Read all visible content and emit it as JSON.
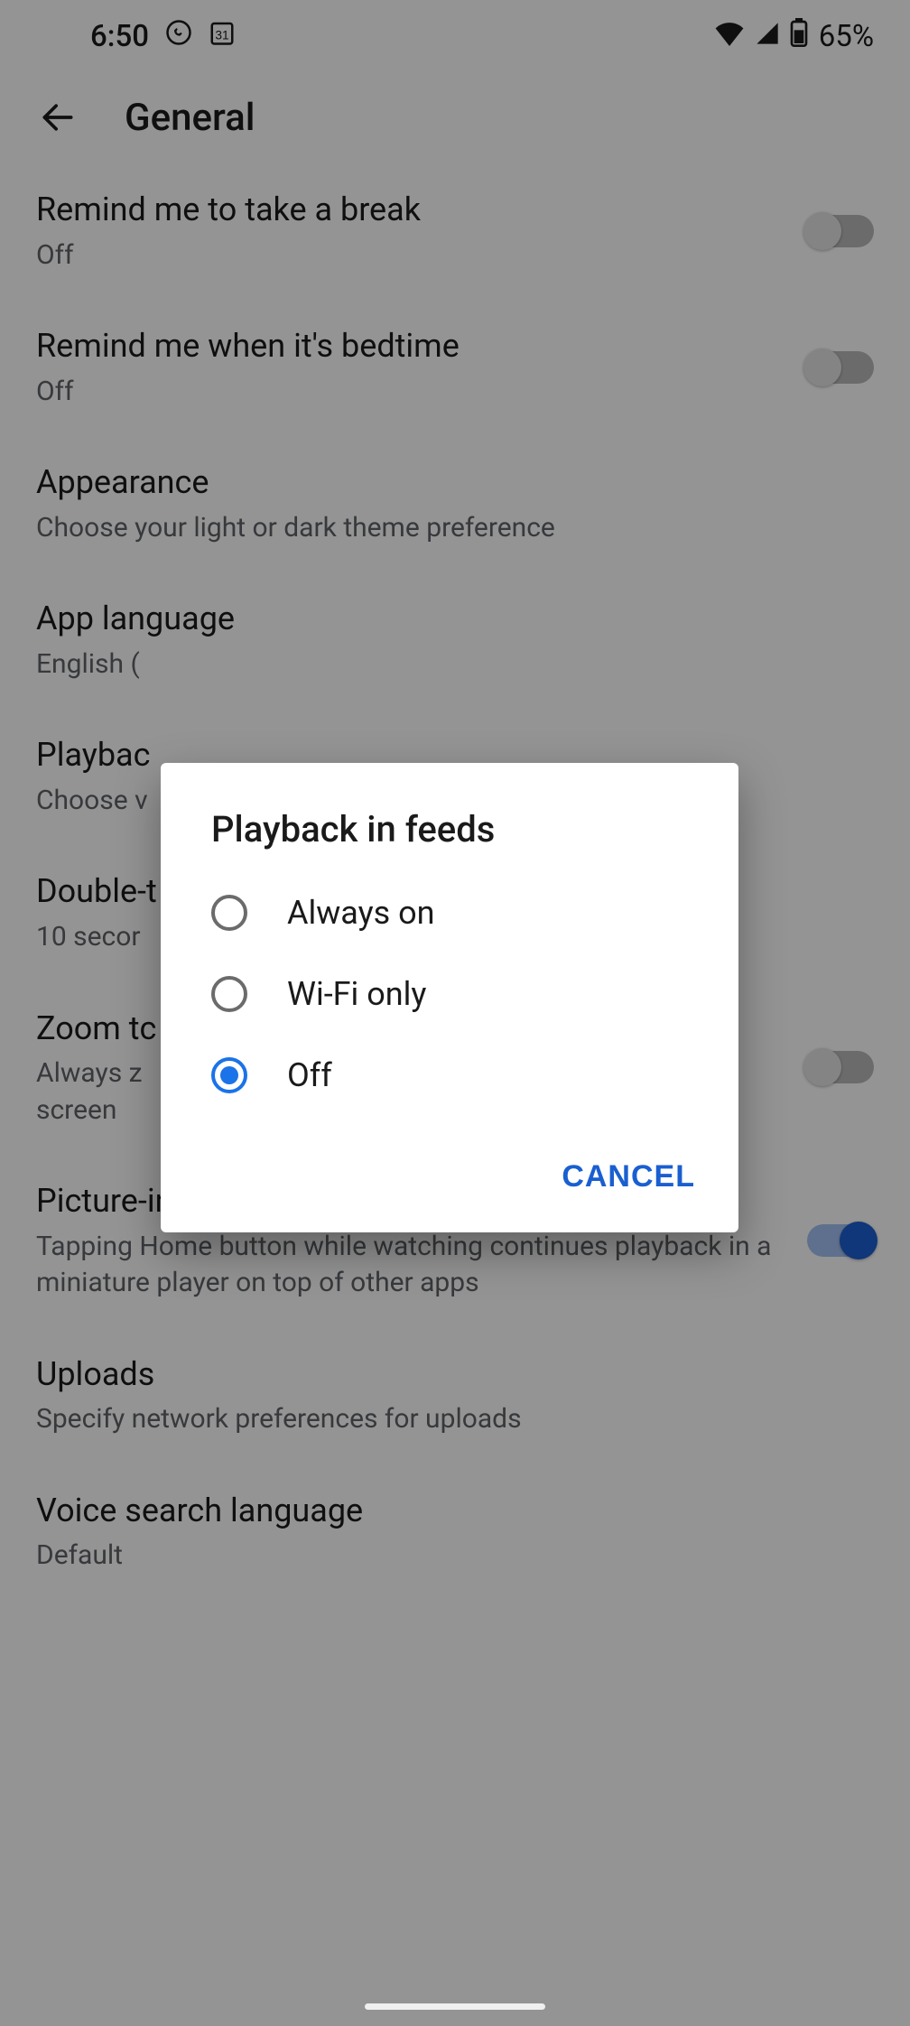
{
  "status": {
    "time": "6:50",
    "battery": "65%"
  },
  "header": {
    "title": "General"
  },
  "settings": {
    "break": {
      "title": "Remind me to take a break",
      "sub": "Off"
    },
    "bedtime": {
      "title": "Remind me when it's bedtime",
      "sub": "Off"
    },
    "appearance": {
      "title": "Appearance",
      "sub": "Choose your light or dark theme preference"
    },
    "language": {
      "title": "App language",
      "sub": "English ("
    },
    "playback": {
      "title": "Playbac",
      "sub": "Choose v"
    },
    "doubletap": {
      "title": "Double-t",
      "sub": "10 secor"
    },
    "zoom": {
      "title": "Zoom tc",
      "sub": "Always z\nscreen"
    },
    "pip": {
      "title": "Picture-in-picture",
      "sub": "Tapping Home button while watching continues playback in a miniature player on top of other apps"
    },
    "uploads": {
      "title": "Uploads",
      "sub": "Specify network preferences for uploads"
    },
    "voice": {
      "title": "Voice search language",
      "sub": "Default"
    }
  },
  "dialog": {
    "title": "Playback in feeds",
    "options": {
      "always": "Always on",
      "wifi": "Wi-Fi only",
      "off": "Off"
    },
    "cancel": "CANCEL"
  }
}
